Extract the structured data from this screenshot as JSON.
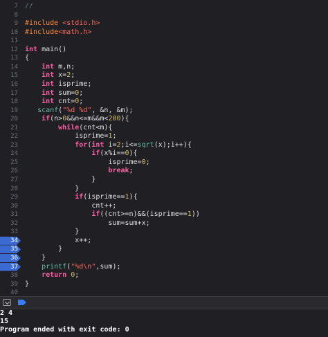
{
  "editor": {
    "lines": [
      {
        "num": "7",
        "bp": false,
        "tokens": [
          {
            "t": "//",
            "c": "comment"
          }
        ]
      },
      {
        "num": "8",
        "bp": false,
        "tokens": []
      },
      {
        "num": "9",
        "bp": false,
        "tokens": [
          {
            "t": "#include ",
            "c": "preproc"
          },
          {
            "t": "<stdio.h>",
            "c": "string"
          }
        ]
      },
      {
        "num": "10",
        "bp": false,
        "tokens": [
          {
            "t": "#include",
            "c": "preproc"
          },
          {
            "t": "<math.h>",
            "c": "string"
          }
        ]
      },
      {
        "num": "11",
        "bp": false,
        "tokens": []
      },
      {
        "num": "12",
        "bp": false,
        "tokens": [
          {
            "t": "int",
            "c": "keyword"
          },
          {
            "t": " main()",
            "c": "plain"
          }
        ]
      },
      {
        "num": "13",
        "bp": false,
        "tokens": [
          {
            "t": "{",
            "c": "plain"
          }
        ]
      },
      {
        "num": "14",
        "bp": false,
        "tokens": [
          {
            "t": "    ",
            "c": "plain"
          },
          {
            "t": "int",
            "c": "keyword"
          },
          {
            "t": " m,n;",
            "c": "plain"
          }
        ]
      },
      {
        "num": "15",
        "bp": false,
        "tokens": [
          {
            "t": "    ",
            "c": "plain"
          },
          {
            "t": "int",
            "c": "keyword"
          },
          {
            "t": " x=",
            "c": "plain"
          },
          {
            "t": "2",
            "c": "number"
          },
          {
            "t": ";",
            "c": "plain"
          }
        ]
      },
      {
        "num": "16",
        "bp": false,
        "tokens": [
          {
            "t": "    ",
            "c": "plain"
          },
          {
            "t": "int",
            "c": "keyword"
          },
          {
            "t": " isprime;",
            "c": "plain"
          }
        ]
      },
      {
        "num": "17",
        "bp": false,
        "tokens": [
          {
            "t": "    ",
            "c": "plain"
          },
          {
            "t": "int",
            "c": "keyword"
          },
          {
            "t": " sum=",
            "c": "plain"
          },
          {
            "t": "0",
            "c": "number"
          },
          {
            "t": ";",
            "c": "plain"
          }
        ]
      },
      {
        "num": "18",
        "bp": false,
        "tokens": [
          {
            "t": "    ",
            "c": "plain"
          },
          {
            "t": "int",
            "c": "keyword"
          },
          {
            "t": " cnt=",
            "c": "plain"
          },
          {
            "t": "0",
            "c": "number"
          },
          {
            "t": ";",
            "c": "plain"
          }
        ]
      },
      {
        "num": "19",
        "bp": false,
        "tokens": [
          {
            "t": "   ",
            "c": "plain"
          },
          {
            "t": "scanf",
            "c": "func"
          },
          {
            "t": "(",
            "c": "plain"
          },
          {
            "t": "\"%d %d\"",
            "c": "string"
          },
          {
            "t": ", &n, &m);",
            "c": "plain"
          }
        ]
      },
      {
        "num": "20",
        "bp": false,
        "tokens": [
          {
            "t": "    ",
            "c": "plain"
          },
          {
            "t": "if",
            "c": "keyword"
          },
          {
            "t": "(n>",
            "c": "plain"
          },
          {
            "t": "0",
            "c": "number"
          },
          {
            "t": "&&n<=m&&m<",
            "c": "plain"
          },
          {
            "t": "200",
            "c": "number"
          },
          {
            "t": "){",
            "c": "plain"
          }
        ]
      },
      {
        "num": "21",
        "bp": false,
        "tokens": [
          {
            "t": "        ",
            "c": "plain"
          },
          {
            "t": "while",
            "c": "keyword"
          },
          {
            "t": "(cnt<m){",
            "c": "plain"
          }
        ]
      },
      {
        "num": "22",
        "bp": false,
        "tokens": [
          {
            "t": "            isprime=",
            "c": "plain"
          },
          {
            "t": "1",
            "c": "number"
          },
          {
            "t": ";",
            "c": "plain"
          }
        ]
      },
      {
        "num": "23",
        "bp": false,
        "tokens": [
          {
            "t": "            ",
            "c": "plain"
          },
          {
            "t": "for",
            "c": "keyword"
          },
          {
            "t": "(",
            "c": "plain"
          },
          {
            "t": "int",
            "c": "keyword"
          },
          {
            "t": " i=",
            "c": "plain"
          },
          {
            "t": "2",
            "c": "number"
          },
          {
            "t": ";i<=",
            "c": "plain"
          },
          {
            "t": "sqrt",
            "c": "func"
          },
          {
            "t": "(x);i++){",
            "c": "plain"
          }
        ]
      },
      {
        "num": "24",
        "bp": false,
        "tokens": [
          {
            "t": "                ",
            "c": "plain"
          },
          {
            "t": "if",
            "c": "keyword"
          },
          {
            "t": "(x%i==",
            "c": "plain"
          },
          {
            "t": "0",
            "c": "number"
          },
          {
            "t": "){",
            "c": "plain"
          }
        ]
      },
      {
        "num": "25",
        "bp": false,
        "tokens": [
          {
            "t": "                    isprime=",
            "c": "plain"
          },
          {
            "t": "0",
            "c": "number"
          },
          {
            "t": ";",
            "c": "plain"
          }
        ]
      },
      {
        "num": "26",
        "bp": false,
        "tokens": [
          {
            "t": "                    ",
            "c": "plain"
          },
          {
            "t": "break",
            "c": "keyword"
          },
          {
            "t": ";",
            "c": "plain"
          }
        ]
      },
      {
        "num": "27",
        "bp": false,
        "tokens": [
          {
            "t": "                }",
            "c": "plain"
          }
        ]
      },
      {
        "num": "28",
        "bp": false,
        "tokens": [
          {
            "t": "            }",
            "c": "plain"
          }
        ]
      },
      {
        "num": "29",
        "bp": false,
        "tokens": [
          {
            "t": "            ",
            "c": "plain"
          },
          {
            "t": "if",
            "c": "keyword"
          },
          {
            "t": "(isprime==",
            "c": "plain"
          },
          {
            "t": "1",
            "c": "number"
          },
          {
            "t": "){",
            "c": "plain"
          }
        ]
      },
      {
        "num": "30",
        "bp": false,
        "tokens": [
          {
            "t": "                cnt++;",
            "c": "plain"
          }
        ]
      },
      {
        "num": "31",
        "bp": false,
        "tokens": [
          {
            "t": "                ",
            "c": "plain"
          },
          {
            "t": "if",
            "c": "keyword"
          },
          {
            "t": "((cnt>=n)&&(isprime==",
            "c": "plain"
          },
          {
            "t": "1",
            "c": "number"
          },
          {
            "t": "))",
            "c": "plain"
          }
        ]
      },
      {
        "num": "32",
        "bp": false,
        "tokens": [
          {
            "t": "                    sum=sum+x;",
            "c": "plain"
          }
        ]
      },
      {
        "num": "33",
        "bp": false,
        "tokens": [
          {
            "t": "            }",
            "c": "plain"
          }
        ]
      },
      {
        "num": "34",
        "bp": true,
        "tokens": [
          {
            "t": "            x++;",
            "c": "plain"
          }
        ]
      },
      {
        "num": "35",
        "bp": true,
        "tokens": [
          {
            "t": "        }",
            "c": "plain"
          }
        ]
      },
      {
        "num": "36",
        "bp": true,
        "tokens": [
          {
            "t": "    }",
            "c": "plain"
          }
        ]
      },
      {
        "num": "37",
        "bp": true,
        "tokens": [
          {
            "t": "    ",
            "c": "plain"
          },
          {
            "t": "printf",
            "c": "func"
          },
          {
            "t": "(",
            "c": "plain"
          },
          {
            "t": "\"%d\\n\"",
            "c": "string"
          },
          {
            "t": ",sum);",
            "c": "plain"
          }
        ]
      },
      {
        "num": "38",
        "bp": false,
        "tokens": [
          {
            "t": "    ",
            "c": "plain"
          },
          {
            "t": "return",
            "c": "keyword"
          },
          {
            "t": " ",
            "c": "plain"
          },
          {
            "t": "0",
            "c": "number"
          },
          {
            "t": ";",
            "c": "plain"
          }
        ]
      },
      {
        "num": "39",
        "bp": false,
        "tokens": [
          {
            "t": "}",
            "c": "plain"
          }
        ]
      },
      {
        "num": "40",
        "bp": false,
        "tokens": []
      }
    ]
  },
  "debug_bar": {
    "hide_icon": "chevron-down-icon",
    "continue_icon": "continue-icon"
  },
  "console": {
    "lines": [
      "2 4",
      "15",
      "Program ended with exit code: 0"
    ]
  },
  "colors": {
    "background": "#1f1f24",
    "breakpoint": "#3b6ad0",
    "keyword": "#fc5fa3",
    "preprocessor": "#fd8f3f",
    "string": "#fc6a5d",
    "number": "#d0bf69",
    "function": "#67b7a4"
  }
}
